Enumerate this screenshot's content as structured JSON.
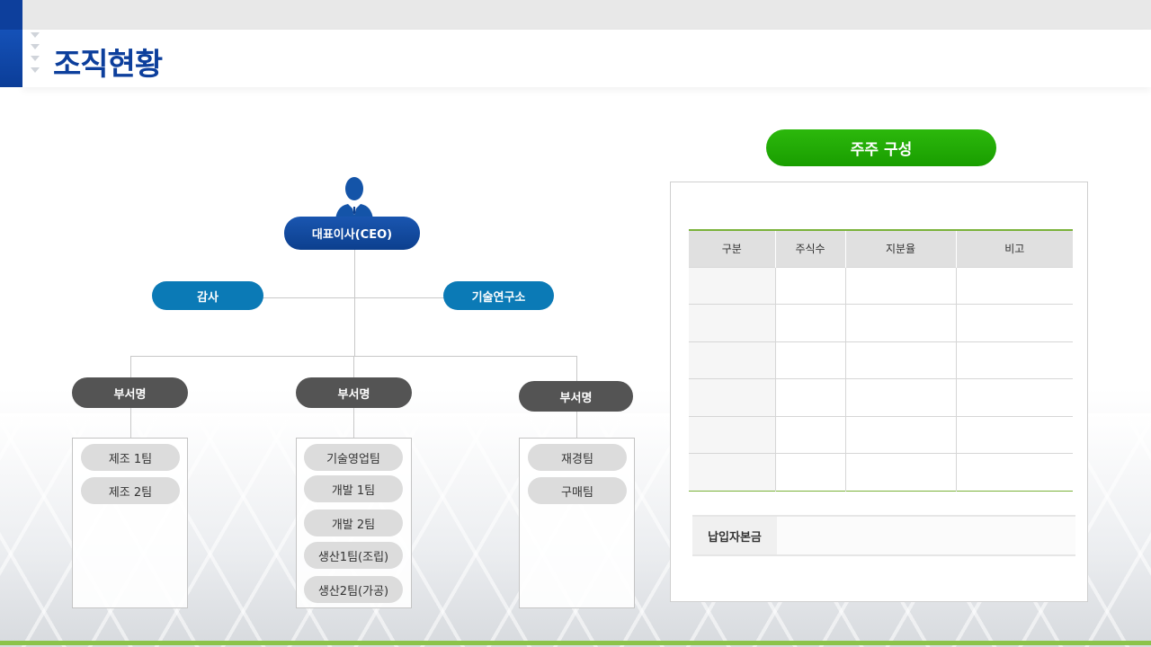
{
  "header": {
    "title": "조직현황"
  },
  "org": {
    "ceo": "대표이사(CEO)",
    "audit": "감사",
    "lab": "기술연구소",
    "departments": [
      {
        "label": "부서명",
        "teams": [
          "제조 1팀",
          "제조 2팀"
        ]
      },
      {
        "label": "부서명",
        "teams": [
          "기술영업팀",
          "개발 1팀",
          "개발 2팀",
          "생산1팀(조립)",
          "생산2팀(가공)"
        ]
      },
      {
        "label": "부서명",
        "teams": [
          "재경팀",
          "구매팀"
        ]
      }
    ]
  },
  "shareholders": {
    "title": "주주 구성",
    "columns": [
      "구분",
      "주식수",
      "지분율",
      "비고"
    ],
    "rows": 6,
    "capital_label": "납입자본금",
    "capital_value": ""
  },
  "colors": {
    "brand_blue": "#0d3f9c",
    "teal": "#0b7ab6",
    "green": "#1fa806",
    "dept_gray": "#545454",
    "footer_green": "#8cc34a"
  }
}
